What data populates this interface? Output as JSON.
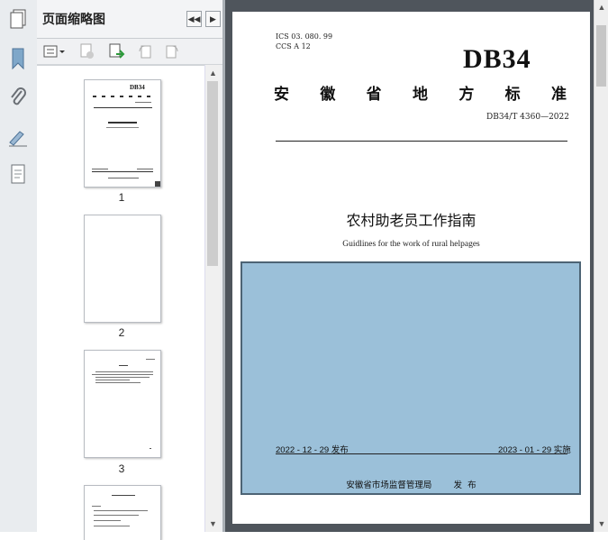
{
  "panel": {
    "title": "页面缩略图",
    "thumbnails": [
      {
        "label": "1"
      },
      {
        "label": "2"
      },
      {
        "label": "3"
      }
    ]
  },
  "icons": {
    "rail": [
      "page-thumbnails-icon",
      "bookmark-icon",
      "attachment-icon",
      "signature-icon",
      "layers-icon"
    ],
    "toolbar": [
      "options-menu-icon",
      "delete-page-icon",
      "insert-page-icon",
      "rotate-ccw-icon",
      "rotate-cw-icon"
    ],
    "header": [
      "prev-icon",
      "next-icon"
    ]
  },
  "document": {
    "ics_line": "ICS  03. 080. 99",
    "ccs_line": "CCS  A 12",
    "logo_text": "DB34",
    "standard_title_chars": [
      "安",
      "徽",
      "省",
      "地",
      "方",
      "标",
      "准"
    ],
    "standard_number": "DB34/T  4360—2022",
    "title_cn": "农村助老员工作指南",
    "title_en": "Guidlines for the work of rural helpages",
    "publish_date": "2022 - 12 - 29 发布",
    "implement_date": "2023 - 01 - 29 实施",
    "issuer": "安徽省市场监督管理局        发  布",
    "overlay_color": "#9bc0d9"
  }
}
